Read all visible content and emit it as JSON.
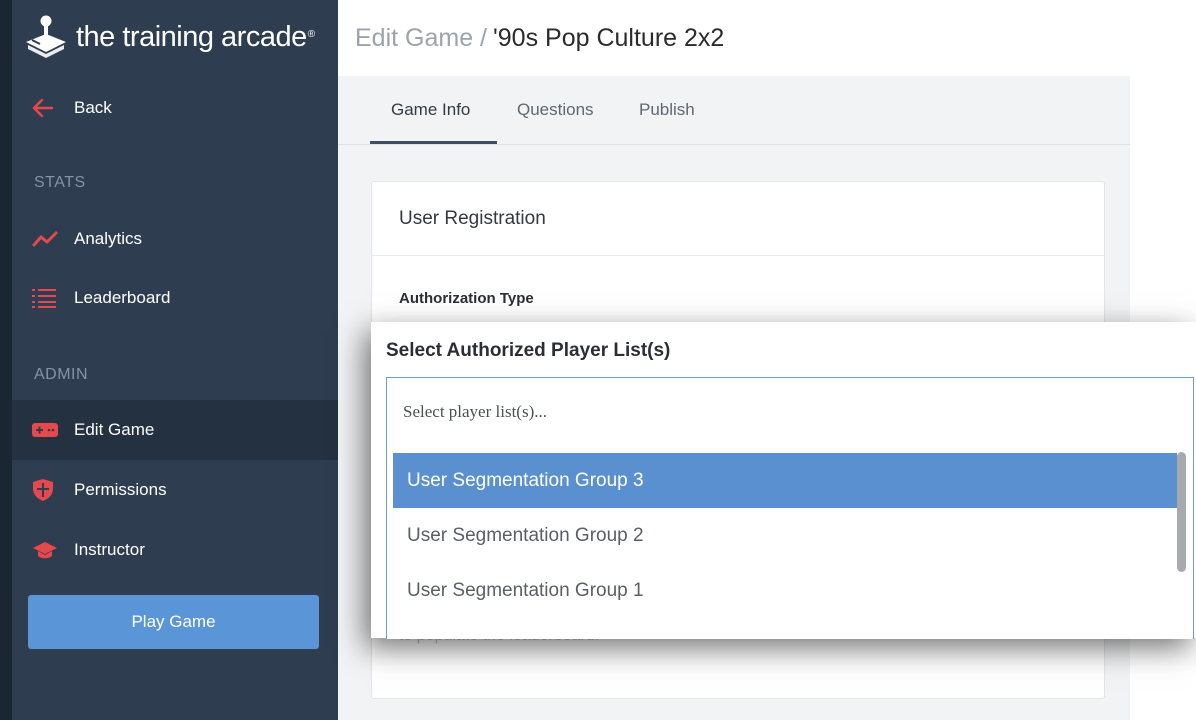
{
  "brand": {
    "logo_text": "the training arcade",
    "logo_mark": "®"
  },
  "sidebar": {
    "back_label": "Back",
    "stats_label": "STATS",
    "admin_label": "ADMIN",
    "items": [
      {
        "label": "Analytics",
        "icon": "analytics-icon"
      },
      {
        "label": "Leaderboard",
        "icon": "leaderboard-icon"
      },
      {
        "label": "Edit Game",
        "icon": "gamepad-icon",
        "active": true
      },
      {
        "label": "Permissions",
        "icon": "shield-icon"
      },
      {
        "label": "Instructor",
        "icon": "graduation-cap-icon"
      }
    ],
    "play_button": "Play Game"
  },
  "header": {
    "prefix": "Edit Game /",
    "game_name": "'90s Pop Culture 2x2"
  },
  "tabs": [
    {
      "label": "Game Info",
      "active": true
    },
    {
      "label": "Questions"
    },
    {
      "label": "Publish"
    }
  ],
  "card": {
    "title": "User Registration",
    "auth_label": "Authorization Type",
    "faded_text": "to populate the leaderboard."
  },
  "popup": {
    "title": "Select Authorized Player List(s)",
    "placeholder": "Select player list(s)...",
    "options": [
      "User Segmentation Group 3",
      "User Segmentation Group 2",
      "User Segmentation Group 1"
    ],
    "highlighted_index": 0
  },
  "colors": {
    "sidebar_bg": "#2e3d4f",
    "accent_red": "#e5484d",
    "accent_blue": "#5a95d8",
    "highlight": "#5b90d0"
  }
}
